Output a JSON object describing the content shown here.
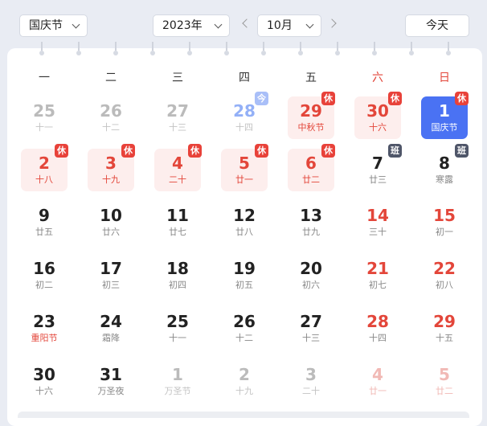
{
  "toolbar": {
    "holiday_select": "国庆节",
    "year_select": "2023年",
    "month_select": "10月",
    "today_button": "今天"
  },
  "weekdays": [
    "一",
    "二",
    "三",
    "四",
    "五",
    "六",
    "日"
  ],
  "weeks": [
    [
      {
        "day": "25",
        "lunar": "十一",
        "other": true
      },
      {
        "day": "26",
        "lunar": "十二",
        "other": true
      },
      {
        "day": "27",
        "lunar": "十三",
        "other": true
      },
      {
        "day": "28",
        "lunar": "十四",
        "other": true,
        "badge": "今",
        "badge_type": "today"
      },
      {
        "day": "29",
        "lunar": "中秋节",
        "badge": "休",
        "badge_type": "rest",
        "rest": true
      },
      {
        "day": "30",
        "lunar": "十六",
        "badge": "休",
        "badge_type": "rest",
        "rest": true
      },
      {
        "day": "1",
        "lunar": "国庆节",
        "badge": "休",
        "badge_type": "rest",
        "selected": true
      }
    ],
    [
      {
        "day": "2",
        "lunar": "十八",
        "badge": "休",
        "badge_type": "rest",
        "rest": true
      },
      {
        "day": "3",
        "lunar": "十九",
        "badge": "休",
        "badge_type": "rest",
        "rest": true
      },
      {
        "day": "4",
        "lunar": "二十",
        "badge": "休",
        "badge_type": "rest",
        "rest": true
      },
      {
        "day": "5",
        "lunar": "廿一",
        "badge": "休",
        "badge_type": "rest",
        "rest": true
      },
      {
        "day": "6",
        "lunar": "廿二",
        "badge": "休",
        "badge_type": "rest",
        "rest": true
      },
      {
        "day": "7",
        "lunar": "廿三",
        "badge": "班",
        "badge_type": "work"
      },
      {
        "day": "8",
        "lunar": "寒露",
        "badge": "班",
        "badge_type": "work"
      }
    ],
    [
      {
        "day": "9",
        "lunar": "廿五"
      },
      {
        "day": "10",
        "lunar": "廿六"
      },
      {
        "day": "11",
        "lunar": "廿七"
      },
      {
        "day": "12",
        "lunar": "廿八"
      },
      {
        "day": "13",
        "lunar": "廿九"
      },
      {
        "day": "14",
        "lunar": "三十",
        "weekend": true
      },
      {
        "day": "15",
        "lunar": "初一",
        "weekend": true
      }
    ],
    [
      {
        "day": "16",
        "lunar": "初二"
      },
      {
        "day": "17",
        "lunar": "初三"
      },
      {
        "day": "18",
        "lunar": "初四"
      },
      {
        "day": "19",
        "lunar": "初五"
      },
      {
        "day": "20",
        "lunar": "初六"
      },
      {
        "day": "21",
        "lunar": "初七",
        "weekend": true
      },
      {
        "day": "22",
        "lunar": "初八",
        "weekend": true
      }
    ],
    [
      {
        "day": "23",
        "lunar": "重阳节",
        "festival": true
      },
      {
        "day": "24",
        "lunar": "霜降"
      },
      {
        "day": "25",
        "lunar": "十一"
      },
      {
        "day": "26",
        "lunar": "十二"
      },
      {
        "day": "27",
        "lunar": "十三"
      },
      {
        "day": "28",
        "lunar": "十四",
        "weekend": true
      },
      {
        "day": "29",
        "lunar": "十五",
        "weekend": true
      }
    ],
    [
      {
        "day": "30",
        "lunar": "十六"
      },
      {
        "day": "31",
        "lunar": "万圣夜"
      },
      {
        "day": "1",
        "lunar": "万圣节",
        "other": true
      },
      {
        "day": "2",
        "lunar": "十九",
        "other": true
      },
      {
        "day": "3",
        "lunar": "二十",
        "other": true
      },
      {
        "day": "4",
        "lunar": "廿一",
        "other": true,
        "weekend": true
      },
      {
        "day": "5",
        "lunar": "廿二",
        "other": true,
        "weekend": true
      }
    ]
  ]
}
